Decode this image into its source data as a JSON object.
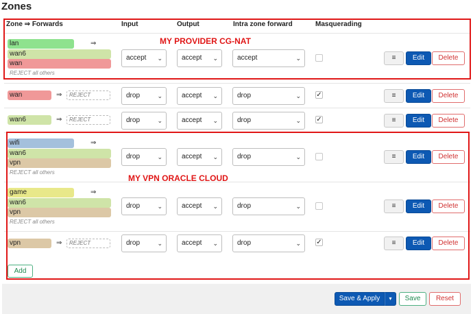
{
  "page": {
    "title": "Zones"
  },
  "headers": {
    "zone_forwards": "Zone ⇒ Forwards",
    "input": "Input",
    "output": "Output",
    "intra_zone_forward": "Intra zone forward",
    "masquerading": "Masquerading"
  },
  "colors": {
    "lan": "#8ee28e",
    "wan6": "#cfe4a8",
    "wan": "#f09898",
    "wifi": "#a4c0dc",
    "vpn": "#dcc8a6",
    "game": "#e8e88a",
    "annotation_red": "#e01616",
    "primary_blue": "#0d59b3"
  },
  "arrow": "⇒",
  "reject_all": "REJECT all others",
  "reject": "REJECT",
  "menu_icon": "≡",
  "edit_label": "Edit",
  "delete_label": "Delete",
  "rows": [
    {
      "zone": "lan",
      "forwards": [
        "wan6",
        "wan"
      ],
      "input": "accept",
      "output": "accept",
      "forward": "accept",
      "masquerading": false
    },
    {
      "zone": "wan",
      "forwards": [],
      "input": "drop",
      "output": "accept",
      "forward": "drop",
      "masquerading": true
    },
    {
      "zone": "wan6",
      "forwards": [],
      "input": "drop",
      "output": "accept",
      "forward": "drop",
      "masquerading": true
    },
    {
      "zone": "wifi",
      "forwards": [
        "wan6",
        "vpn"
      ],
      "input": "drop",
      "output": "accept",
      "forward": "drop",
      "masquerading": false
    },
    {
      "zone": "game",
      "forwards": [
        "wan6",
        "vpn"
      ],
      "input": "drop",
      "output": "accept",
      "forward": "drop",
      "masquerading": false
    },
    {
      "zone": "vpn",
      "forwards": [],
      "input": "drop",
      "output": "accept",
      "forward": "drop",
      "masquerading": true
    }
  ],
  "annotations": {
    "provider": "MY PROVIDER CG-NAT",
    "vpn": "MY VPN ORACLE CLOUD"
  },
  "add_label": "Add",
  "footer": {
    "save_apply": "Save & Apply",
    "save": "Save",
    "reset": "Reset"
  }
}
